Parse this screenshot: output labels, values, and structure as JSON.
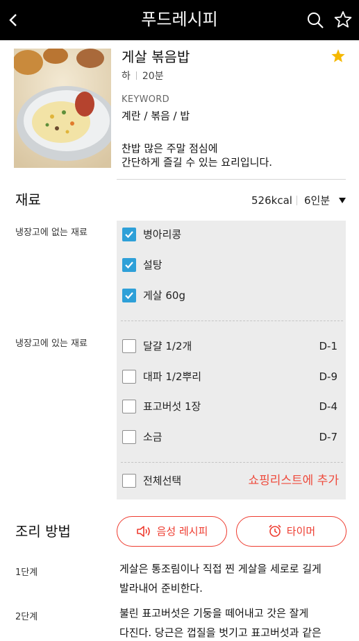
{
  "header": {
    "title": "푸드레시피",
    "icons": [
      "back-arrow-icon",
      "search-icon",
      "star-outline-icon"
    ]
  },
  "recipe": {
    "title": "게살 볶음밥",
    "difficulty": "하",
    "time": "20분",
    "keyword_label": "KEYWORD",
    "keywords": "계란 / 볶음 / 밥",
    "description_line1": "찬밥 많은 주말 점심에",
    "description_line2": "간단하게 즐길 수 있는 요리입니다.",
    "favorite_color": "#f5b800"
  },
  "ingredients": {
    "title": "재료",
    "kcal": "526kcal",
    "servings": "6인분",
    "missing_label": "냉장고에 없는 재료",
    "have_label": "냉장고에 있는 재료",
    "missing": [
      {
        "name": "병아리콩",
        "checked": true
      },
      {
        "name": "설탕",
        "checked": true
      },
      {
        "name": "게살 60g",
        "checked": true
      }
    ],
    "have": [
      {
        "name": "달걀 1/2개",
        "dday": "D-1",
        "checked": false
      },
      {
        "name": "대파 1/2뿌리",
        "dday": "D-9",
        "checked": false
      },
      {
        "name": "표고버섯 1장",
        "dday": "D-4",
        "checked": false
      },
      {
        "name": "소금",
        "dday": "D-7",
        "checked": false
      }
    ],
    "select_all": "전체선택",
    "add_to_shopping": "쇼핑리스트에 추가",
    "accent_color": "#ee4a3c",
    "check_color": "#2ea0d8"
  },
  "cooking": {
    "title": "조리 방법",
    "voice_button": "음성 레시피",
    "timer_button": "타이머",
    "steps": [
      {
        "label": "1단계",
        "line1": "게살은 통조림이나 직접 찐 게살을 세로로 길게",
        "line2": "발라내어 준비한다."
      },
      {
        "label": "2단계",
        "line1": "불린 표고버섯은 기둥을 떼어내고 갓은 잘게",
        "line2": "다진다. 당근은 껍질을 벗기고 표고버섯과 같은"
      }
    ]
  }
}
